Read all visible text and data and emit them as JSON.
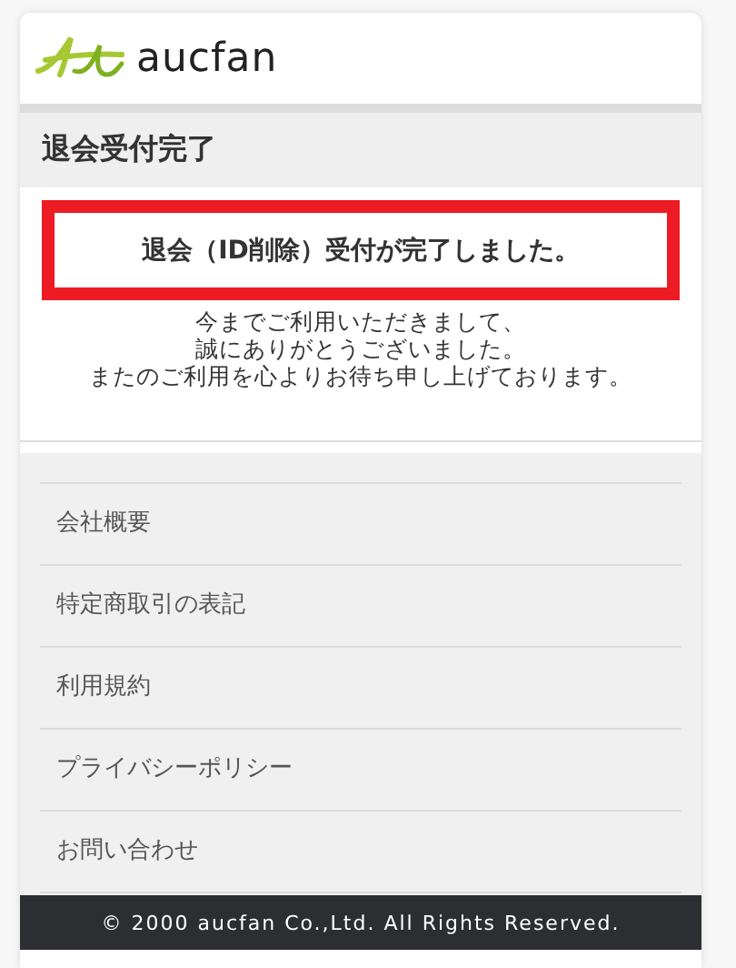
{
  "header": {
    "logo_text": "aucfan"
  },
  "page_title": "退会受付完了",
  "notice": {
    "headline": "退会（ID削除）受付が完了しました。",
    "message_lines": [
      "今までご利用いただきまして、",
      "誠にありがとうございました。",
      "またのご利用を心よりお待ち申し上げております。"
    ]
  },
  "footer_links": [
    "会社概要",
    "特定商取引の表記",
    "利用規約",
    "プライバシーポリシー",
    "お問い合わせ"
  ],
  "copyright": "© 2000 aucfan Co.,Ltd. All Rights Reserved."
}
